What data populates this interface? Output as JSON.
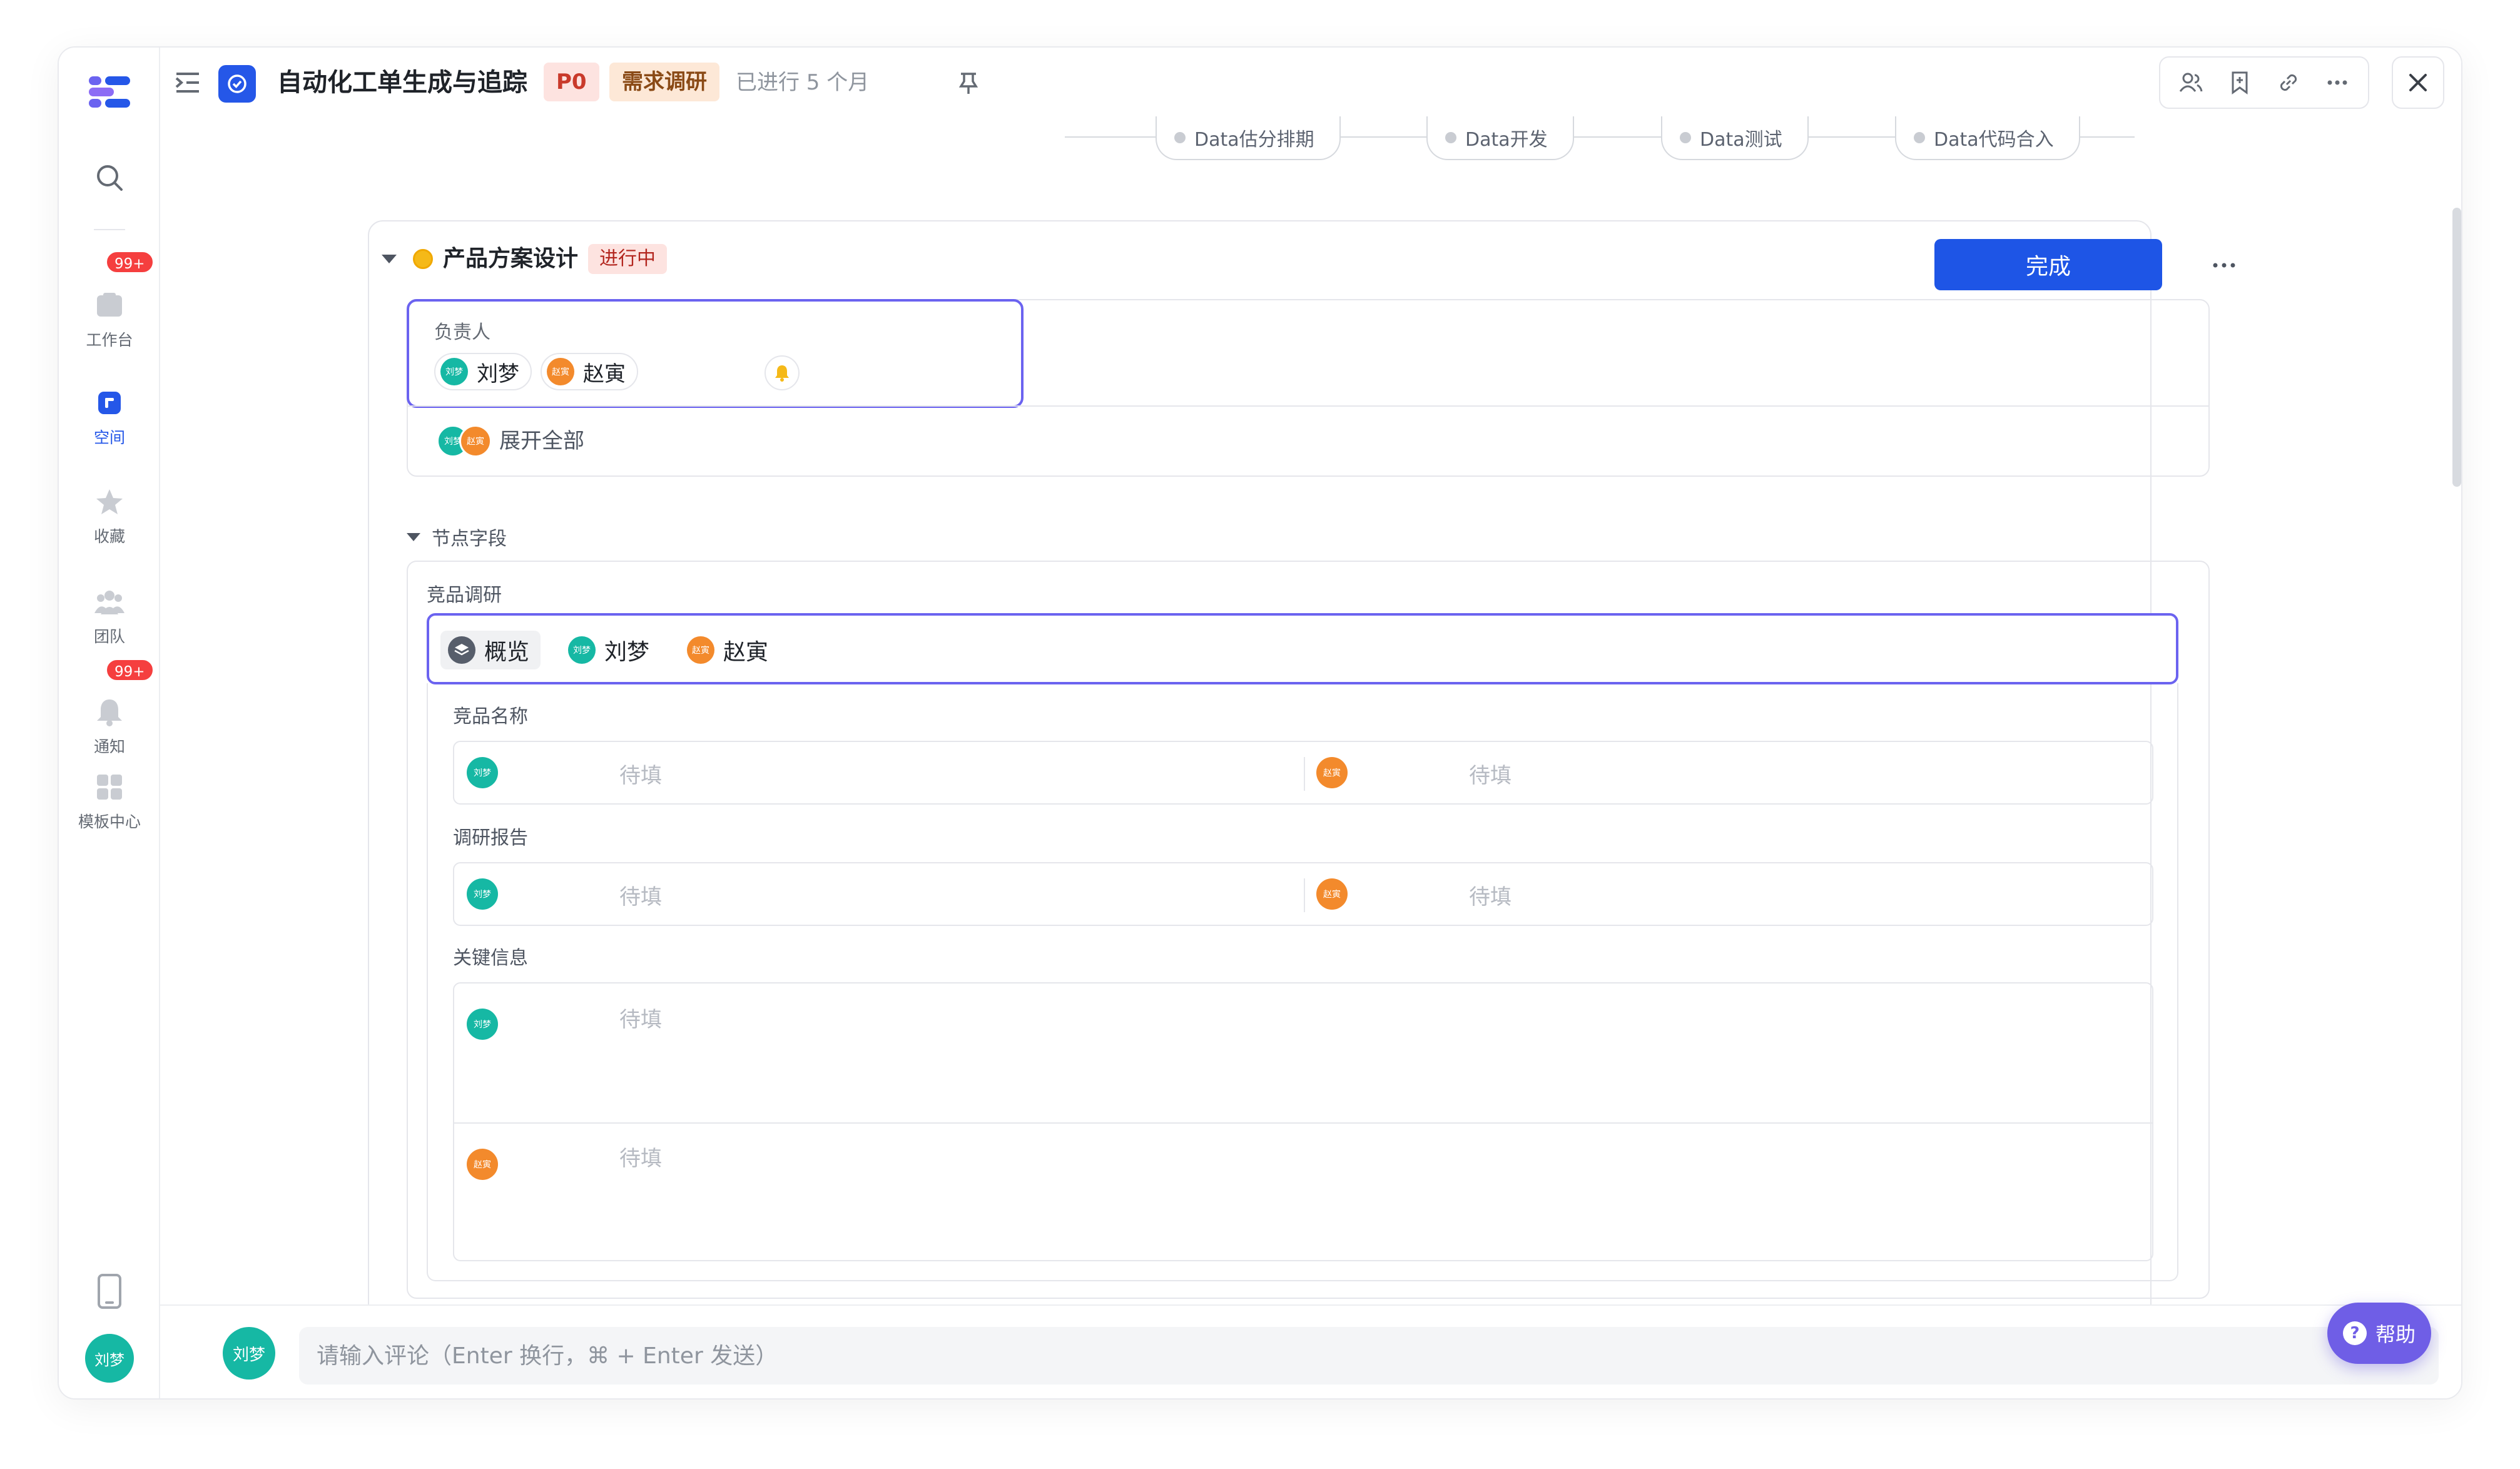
{
  "rail": {
    "items": [
      {
        "label": "工作台",
        "icon": "workbench-icon",
        "badge": "99+"
      },
      {
        "label": "空间",
        "icon": "space-icon",
        "active": true
      },
      {
        "label": "收藏",
        "icon": "star-icon"
      },
      {
        "label": "团队",
        "icon": "team-icon"
      },
      {
        "label": "通知",
        "icon": "bell-icon",
        "badge": "99+"
      },
      {
        "label": "模板中心",
        "icon": "template-icon"
      }
    ],
    "user_avatar": "刘梦"
  },
  "header": {
    "title": "自动化工单生成与追踪",
    "priority": "P0",
    "stage": "需求调研",
    "duration": "已进行 5 个月"
  },
  "workflow": {
    "nodes": [
      "Data估分排期",
      "Data开发",
      "Data测试",
      "Data代码合入"
    ]
  },
  "node": {
    "title": "产品方案设计",
    "status": "进行中",
    "done_label": "完成",
    "owner_label": "负责人",
    "owners": [
      {
        "name": "刘梦",
        "short": "刘梦"
      },
      {
        "name": "赵寅",
        "short": "赵寅"
      }
    ],
    "expand_label": "展开全部",
    "fields_section": "节点字段",
    "group": {
      "label": "竞品调研",
      "tabs": [
        {
          "label": "概览",
          "icon": "layers-icon"
        },
        {
          "label": "刘梦",
          "avatar": "刘梦"
        },
        {
          "label": "赵寅",
          "avatar": "赵寅"
        }
      ],
      "fields": [
        {
          "label": "竞品名称",
          "left_placeholder": "待填",
          "right_placeholder": "待填"
        },
        {
          "label": "调研报告",
          "left_placeholder": "待填",
          "right_placeholder": "待填"
        },
        {
          "label": "关键信息",
          "top_placeholder": "待填",
          "bottom_placeholder": "待填"
        }
      ]
    }
  },
  "comment": {
    "avatar": "刘梦",
    "placeholder": "请输入评论（Enter 换行，⌘ + Enter 发送）"
  },
  "help": {
    "label": "帮助"
  },
  "colors": {
    "brand": "#2557e8",
    "focus": "#6b63f0",
    "teal": "#16b8a4",
    "orange": "#f38a2c"
  }
}
